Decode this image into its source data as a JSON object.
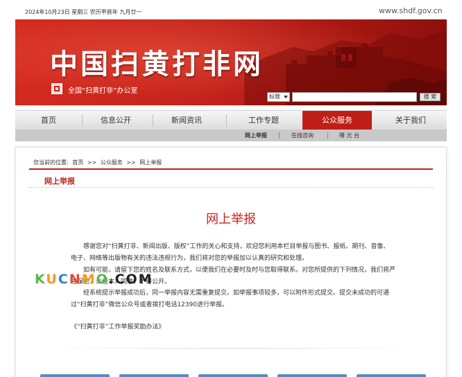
{
  "topbar": {
    "date": "2024年10月23日 星期三 农历甲辰年 九月廿一",
    "domain": "www.shdf.gov.cn"
  },
  "banner": {
    "site_title": "中国扫黄打非网",
    "office_name": "全国“扫黄打非”办公室"
  },
  "search": {
    "select_value": "标题",
    "input_value": "",
    "button_label": "搜 索"
  },
  "nav": {
    "items": [
      "首页",
      "信息公开",
      "新闻资讯",
      "工作专题",
      "公众服务",
      "关于我们"
    ],
    "active": "公众服务"
  },
  "subnav": {
    "items": [
      "网上举报",
      "在线咨询",
      "曝 光 台"
    ],
    "active": "网上举报"
  },
  "breadcrumb": {
    "prefix": "您当前的位置:",
    "parts": [
      "首页",
      ">>",
      "公众服务",
      ">>",
      "网上举报"
    ]
  },
  "section_title": "网上举报",
  "article": {
    "title": "网上举报",
    "paragraphs": [
      "感谢您对“扫黄打非、新闻出版、版权”工作的关心和支持，欢迎您利用本栏目举报与图书、报纸、期刊、音像、电子、网络等出版物有关的违法违规行为，我们将对您的举报加以认真的研究和处理。",
      "如有可能，请留下您的姓名及联系方式，以便我们在必要时及时与您取得联系。对您所提供的下列情况，我们将严格保密，未经本人同意，不得公开。",
      "经系统提示举报成功后，同一举报内容无需重复提交。如举报事项较多，可以附件形式提交。提交未成功的可通过“扫黄打非”微信公众号或者拨打电话12390进行举报。"
    ],
    "rule_link": "《“扫黄打非”工作举报奖励办法》"
  },
  "watermark": [
    "K",
    "U",
    "C",
    "N",
    "M",
    "O",
    ".",
    "C",
    "O",
    "M"
  ],
  "colors": {
    "brand_red": "#c01f17",
    "title_red": "#d21e17"
  }
}
